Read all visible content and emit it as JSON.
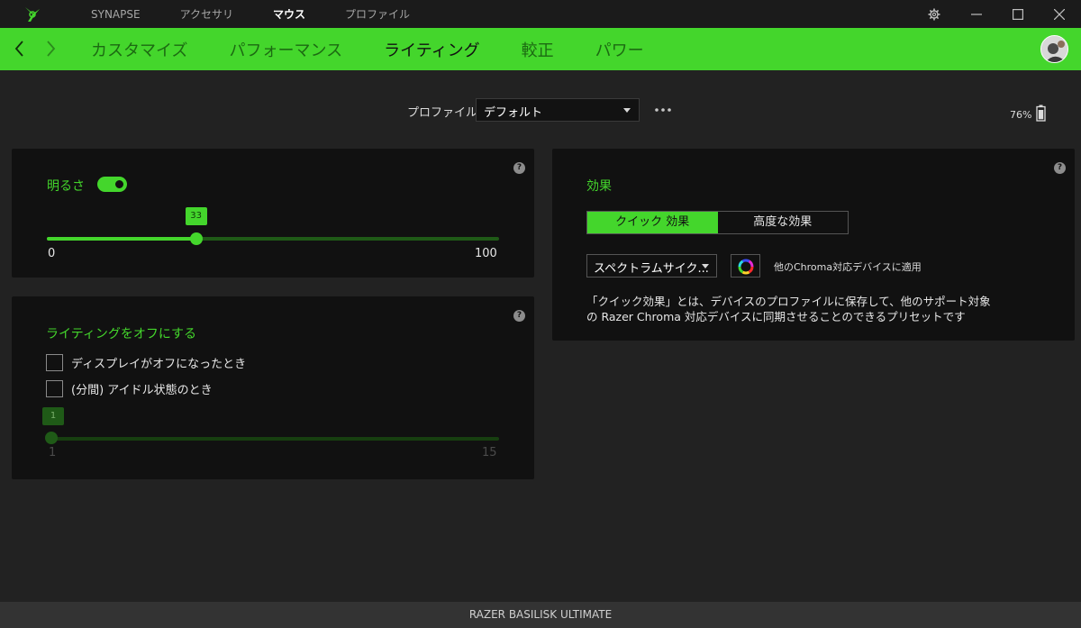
{
  "topnav": {
    "items": [
      "SYNAPSE",
      "アクセサリ",
      "マウス",
      "プロファイル"
    ],
    "active": "マウス"
  },
  "subnav": {
    "tabs": [
      "カスタマイズ",
      "パフォーマンス",
      "ライティング",
      "較正",
      "パワー"
    ],
    "active": "ライティング"
  },
  "profile": {
    "label": "プロファイル",
    "selected": "デフォルト"
  },
  "battery": {
    "percent_text": "76%"
  },
  "brightness": {
    "title": "明るさ",
    "enabled": true,
    "value": 33,
    "min": 0,
    "max": 100,
    "min_label": "0",
    "max_label": "100",
    "value_label": "33"
  },
  "lighting_off": {
    "title": "ライティングをオフにする",
    "options": [
      "ディスプレイがオフになったとき",
      "(分間) アイドル状態のとき"
    ],
    "idle_slider": {
      "value": 1,
      "min": 1,
      "max": 15,
      "min_label": "1",
      "max_label": "15",
      "value_label": "1"
    }
  },
  "effects": {
    "title": "効果",
    "tabs": [
      "クイック 効果",
      "高度な効果"
    ],
    "active_tab": "クイック 効果",
    "selected_effect": "スペクトラムサイク...",
    "apply_label": "他のChroma対応デバイスに適用",
    "description": "「クイック効果」とは、デバイスのプロファイルに保存して、他のサポート対象の Razer Chroma 対応デバイスに同期させることのできるプリセットです"
  },
  "help_mark": "?",
  "footer": {
    "device_name": "RAZER BASILISK ULTIMATE"
  },
  "colors": {
    "accent": "#44d62c",
    "panel": "#111111",
    "background": "#222222"
  }
}
